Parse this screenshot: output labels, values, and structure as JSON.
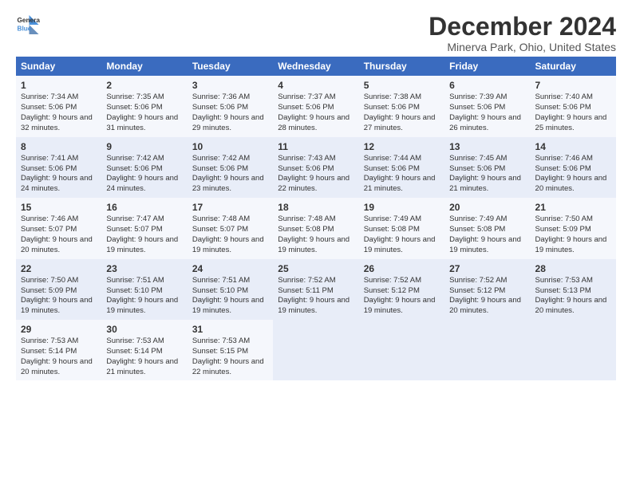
{
  "header": {
    "logo_line1": "General",
    "logo_line2": "Blue",
    "title": "December 2024",
    "subtitle": "Minerva Park, Ohio, United States"
  },
  "weekdays": [
    "Sunday",
    "Monday",
    "Tuesday",
    "Wednesday",
    "Thursday",
    "Friday",
    "Saturday"
  ],
  "weeks": [
    [
      {
        "day": "1",
        "sunrise": "Sunrise: 7:34 AM",
        "sunset": "Sunset: 5:06 PM",
        "daylight": "Daylight: 9 hours and 32 minutes."
      },
      {
        "day": "2",
        "sunrise": "Sunrise: 7:35 AM",
        "sunset": "Sunset: 5:06 PM",
        "daylight": "Daylight: 9 hours and 31 minutes."
      },
      {
        "day": "3",
        "sunrise": "Sunrise: 7:36 AM",
        "sunset": "Sunset: 5:06 PM",
        "daylight": "Daylight: 9 hours and 29 minutes."
      },
      {
        "day": "4",
        "sunrise": "Sunrise: 7:37 AM",
        "sunset": "Sunset: 5:06 PM",
        "daylight": "Daylight: 9 hours and 28 minutes."
      },
      {
        "day": "5",
        "sunrise": "Sunrise: 7:38 AM",
        "sunset": "Sunset: 5:06 PM",
        "daylight": "Daylight: 9 hours and 27 minutes."
      },
      {
        "day": "6",
        "sunrise": "Sunrise: 7:39 AM",
        "sunset": "Sunset: 5:06 PM",
        "daylight": "Daylight: 9 hours and 26 minutes."
      },
      {
        "day": "7",
        "sunrise": "Sunrise: 7:40 AM",
        "sunset": "Sunset: 5:06 PM",
        "daylight": "Daylight: 9 hours and 25 minutes."
      }
    ],
    [
      {
        "day": "8",
        "sunrise": "Sunrise: 7:41 AM",
        "sunset": "Sunset: 5:06 PM",
        "daylight": "Daylight: 9 hours and 24 minutes."
      },
      {
        "day": "9",
        "sunrise": "Sunrise: 7:42 AM",
        "sunset": "Sunset: 5:06 PM",
        "daylight": "Daylight: 9 hours and 24 minutes."
      },
      {
        "day": "10",
        "sunrise": "Sunrise: 7:42 AM",
        "sunset": "Sunset: 5:06 PM",
        "daylight": "Daylight: 9 hours and 23 minutes."
      },
      {
        "day": "11",
        "sunrise": "Sunrise: 7:43 AM",
        "sunset": "Sunset: 5:06 PM",
        "daylight": "Daylight: 9 hours and 22 minutes."
      },
      {
        "day": "12",
        "sunrise": "Sunrise: 7:44 AM",
        "sunset": "Sunset: 5:06 PM",
        "daylight": "Daylight: 9 hours and 21 minutes."
      },
      {
        "day": "13",
        "sunrise": "Sunrise: 7:45 AM",
        "sunset": "Sunset: 5:06 PM",
        "daylight": "Daylight: 9 hours and 21 minutes."
      },
      {
        "day": "14",
        "sunrise": "Sunrise: 7:46 AM",
        "sunset": "Sunset: 5:06 PM",
        "daylight": "Daylight: 9 hours and 20 minutes."
      }
    ],
    [
      {
        "day": "15",
        "sunrise": "Sunrise: 7:46 AM",
        "sunset": "Sunset: 5:07 PM",
        "daylight": "Daylight: 9 hours and 20 minutes."
      },
      {
        "day": "16",
        "sunrise": "Sunrise: 7:47 AM",
        "sunset": "Sunset: 5:07 PM",
        "daylight": "Daylight: 9 hours and 19 minutes."
      },
      {
        "day": "17",
        "sunrise": "Sunrise: 7:48 AM",
        "sunset": "Sunset: 5:07 PM",
        "daylight": "Daylight: 9 hours and 19 minutes."
      },
      {
        "day": "18",
        "sunrise": "Sunrise: 7:48 AM",
        "sunset": "Sunset: 5:08 PM",
        "daylight": "Daylight: 9 hours and 19 minutes."
      },
      {
        "day": "19",
        "sunrise": "Sunrise: 7:49 AM",
        "sunset": "Sunset: 5:08 PM",
        "daylight": "Daylight: 9 hours and 19 minutes."
      },
      {
        "day": "20",
        "sunrise": "Sunrise: 7:49 AM",
        "sunset": "Sunset: 5:08 PM",
        "daylight": "Daylight: 9 hours and 19 minutes."
      },
      {
        "day": "21",
        "sunrise": "Sunrise: 7:50 AM",
        "sunset": "Sunset: 5:09 PM",
        "daylight": "Daylight: 9 hours and 19 minutes."
      }
    ],
    [
      {
        "day": "22",
        "sunrise": "Sunrise: 7:50 AM",
        "sunset": "Sunset: 5:09 PM",
        "daylight": "Daylight: 9 hours and 19 minutes."
      },
      {
        "day": "23",
        "sunrise": "Sunrise: 7:51 AM",
        "sunset": "Sunset: 5:10 PM",
        "daylight": "Daylight: 9 hours and 19 minutes."
      },
      {
        "day": "24",
        "sunrise": "Sunrise: 7:51 AM",
        "sunset": "Sunset: 5:10 PM",
        "daylight": "Daylight: 9 hours and 19 minutes."
      },
      {
        "day": "25",
        "sunrise": "Sunrise: 7:52 AM",
        "sunset": "Sunset: 5:11 PM",
        "daylight": "Daylight: 9 hours and 19 minutes."
      },
      {
        "day": "26",
        "sunrise": "Sunrise: 7:52 AM",
        "sunset": "Sunset: 5:12 PM",
        "daylight": "Daylight: 9 hours and 19 minutes."
      },
      {
        "day": "27",
        "sunrise": "Sunrise: 7:52 AM",
        "sunset": "Sunset: 5:12 PM",
        "daylight": "Daylight: 9 hours and 20 minutes."
      },
      {
        "day": "28",
        "sunrise": "Sunrise: 7:53 AM",
        "sunset": "Sunset: 5:13 PM",
        "daylight": "Daylight: 9 hours and 20 minutes."
      }
    ],
    [
      {
        "day": "29",
        "sunrise": "Sunrise: 7:53 AM",
        "sunset": "Sunset: 5:14 PM",
        "daylight": "Daylight: 9 hours and 20 minutes."
      },
      {
        "day": "30",
        "sunrise": "Sunrise: 7:53 AM",
        "sunset": "Sunset: 5:14 PM",
        "daylight": "Daylight: 9 hours and 21 minutes."
      },
      {
        "day": "31",
        "sunrise": "Sunrise: 7:53 AM",
        "sunset": "Sunset: 5:15 PM",
        "daylight": "Daylight: 9 hours and 22 minutes."
      },
      null,
      null,
      null,
      null
    ]
  ]
}
